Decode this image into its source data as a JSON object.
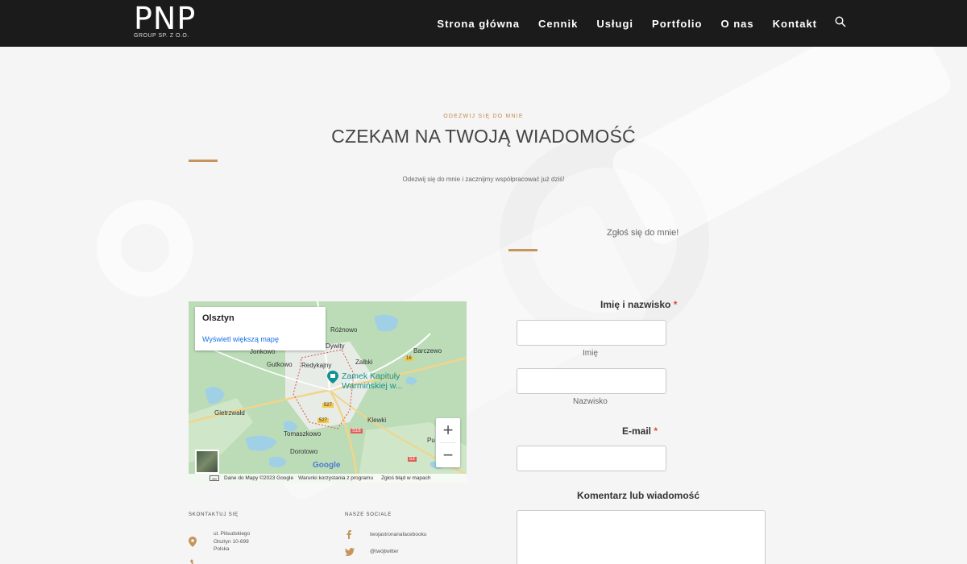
{
  "header": {
    "logo_main": "PNP",
    "logo_sub": "GROUP SP. Z O.O.",
    "nav": [
      "Strona główna",
      "Cennik",
      "Usługi",
      "Portfolio",
      "O nas",
      "Kontakt"
    ],
    "search_icon": "search-icon"
  },
  "hero": {
    "eyebrow": "ODEZWIJ SIĘ DO MNIE",
    "title": "CZEKAM NA TWOJĄ WIADOMOŚĆ",
    "subtitle": "Odezwij się do mnie i zacznijmy współpracować już dziś!",
    "cta": "Zgłoś się do mnie!"
  },
  "colors": {
    "accent": "#c7955c",
    "header_bg": "#1b1b1b",
    "required": "#e14b3b"
  },
  "map": {
    "card_title": "Olsztyn",
    "card_link": "Wyświetl większą mapę",
    "poi": [
      "Zamek Kapituły",
      "Warmińskiej w..."
    ],
    "places": [
      "Różnowo",
      "Dywity",
      "Jonkowo",
      "Barczewo",
      "Gutkowo",
      "Redykajny",
      "Zalbki",
      "Gietrzwałd",
      "Klewki",
      "Tomaszkowo",
      "Dorotowo",
      "Pu"
    ],
    "road_badges": [
      "16",
      "527",
      "527",
      "S16",
      "53"
    ],
    "zoom_in": "+",
    "zoom_out": "−",
    "footer_data": "Dane do Mapy ©2023 Google",
    "footer_terms": "Warunki korzystania z programu",
    "footer_report": "Zgłoś błąd w mapach",
    "logo": "Google"
  },
  "form": {
    "name_label": "Imię i nazwisko",
    "first_help": "Imię",
    "last_help": "Nazwisko",
    "email_label": "E-mail",
    "message_label": "Komentarz lub wiadomość",
    "required_mark": "*"
  },
  "footer": {
    "contact_head": "SKONTAKTUJ SIĘ",
    "address": [
      "ul. Piłsudskiego",
      "Olsztyn 10-699",
      "Polska"
    ],
    "social_head": "NASZE SOCIALE",
    "facebook": "twojastronanafacebooku",
    "twitter": "@twójtwitter"
  }
}
